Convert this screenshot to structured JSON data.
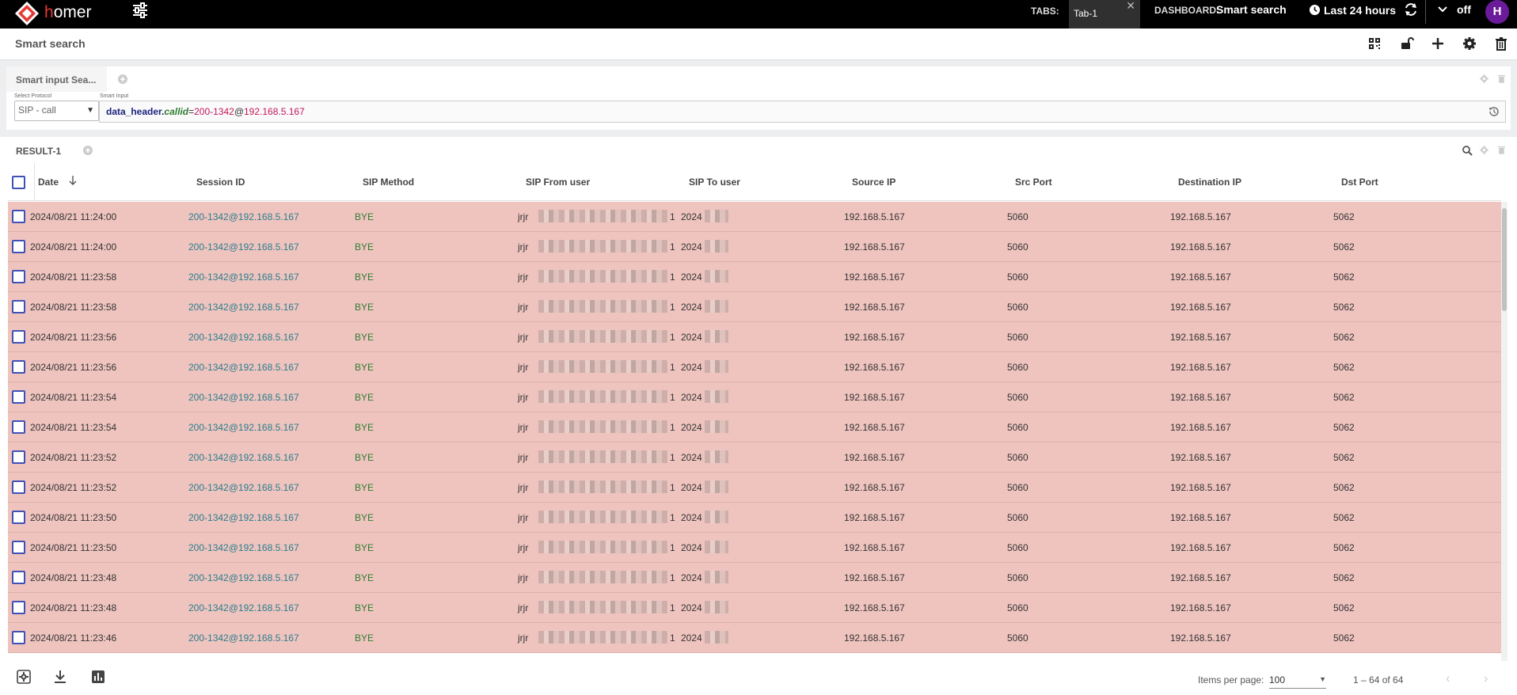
{
  "app": {
    "logo_h": "h",
    "logo_rest": "omer"
  },
  "topbar": {
    "tabs_label": "TABS:",
    "active_tab": "Tab-1",
    "dashboard_label": "DASHBOARD:",
    "dashboard_name": "Smart search",
    "time_range": "Last 24 hours",
    "toggle_label": "off",
    "avatar_initial": "H"
  },
  "page": {
    "title": "Smart search"
  },
  "smart_input_panel": {
    "tab_label": "Smart input Sea...",
    "select_protocol_label": "Select Protocol",
    "smart_input_label": "Smart Input",
    "protocol_value": "SIP - call",
    "query": {
      "key": "data_header",
      "field": "callid",
      "op": "=",
      "value_user": "200-1342",
      "at": "@",
      "value_host": "192.168.5.167"
    }
  },
  "result_panel": {
    "title": "RESULT-1",
    "columns": [
      "Date",
      "Session ID",
      "SIP Method",
      "SIP From user",
      "SIP To user",
      "Source IP",
      "Src Port",
      "Destination IP",
      "Dst Port"
    ],
    "rows": [
      {
        "date": "2024/08/21 11:24:00",
        "sid": "200-1342@192.168.5.167",
        "method": "BYE",
        "from": "jrjr",
        "from_end": "1",
        "to": "2024",
        "src": "192.168.5.167",
        "sport": "5060",
        "dst": "192.168.5.167",
        "dport": "5062"
      },
      {
        "date": "2024/08/21 11:24:00",
        "sid": "200-1342@192.168.5.167",
        "method": "BYE",
        "from": "jrjr",
        "from_end": "1",
        "to": "2024",
        "src": "192.168.5.167",
        "sport": "5060",
        "dst": "192.168.5.167",
        "dport": "5062"
      },
      {
        "date": "2024/08/21 11:23:58",
        "sid": "200-1342@192.168.5.167",
        "method": "BYE",
        "from": "jrjr",
        "from_end": "1",
        "to": "2024",
        "src": "192.168.5.167",
        "sport": "5060",
        "dst": "192.168.5.167",
        "dport": "5062"
      },
      {
        "date": "2024/08/21 11:23:58",
        "sid": "200-1342@192.168.5.167",
        "method": "BYE",
        "from": "jrjr",
        "from_end": "1",
        "to": "2024",
        "src": "192.168.5.167",
        "sport": "5060",
        "dst": "192.168.5.167",
        "dport": "5062"
      },
      {
        "date": "2024/08/21 11:23:56",
        "sid": "200-1342@192.168.5.167",
        "method": "BYE",
        "from": "jrjr",
        "from_end": "1",
        "to": "2024",
        "src": "192.168.5.167",
        "sport": "5060",
        "dst": "192.168.5.167",
        "dport": "5062"
      },
      {
        "date": "2024/08/21 11:23:56",
        "sid": "200-1342@192.168.5.167",
        "method": "BYE",
        "from": "jrjr",
        "from_end": "1",
        "to": "2024",
        "src": "192.168.5.167",
        "sport": "5060",
        "dst": "192.168.5.167",
        "dport": "5062"
      },
      {
        "date": "2024/08/21 11:23:54",
        "sid": "200-1342@192.168.5.167",
        "method": "BYE",
        "from": "jrjr",
        "from_end": "1",
        "to": "2024",
        "src": "192.168.5.167",
        "sport": "5060",
        "dst": "192.168.5.167",
        "dport": "5062"
      },
      {
        "date": "2024/08/21 11:23:54",
        "sid": "200-1342@192.168.5.167",
        "method": "BYE",
        "from": "jrjr",
        "from_end": "1",
        "to": "2024",
        "src": "192.168.5.167",
        "sport": "5060",
        "dst": "192.168.5.167",
        "dport": "5062"
      },
      {
        "date": "2024/08/21 11:23:52",
        "sid": "200-1342@192.168.5.167",
        "method": "BYE",
        "from": "jrjr",
        "from_end": "1",
        "to": "2024",
        "src": "192.168.5.167",
        "sport": "5060",
        "dst": "192.168.5.167",
        "dport": "5062"
      },
      {
        "date": "2024/08/21 11:23:52",
        "sid": "200-1342@192.168.5.167",
        "method": "BYE",
        "from": "jrjr",
        "from_end": "1",
        "to": "2024",
        "src": "192.168.5.167",
        "sport": "5060",
        "dst": "192.168.5.167",
        "dport": "5062"
      },
      {
        "date": "2024/08/21 11:23:50",
        "sid": "200-1342@192.168.5.167",
        "method": "BYE",
        "from": "jrjr",
        "from_end": "1",
        "to": "2024",
        "src": "192.168.5.167",
        "sport": "5060",
        "dst": "192.168.5.167",
        "dport": "5062"
      },
      {
        "date": "2024/08/21 11:23:50",
        "sid": "200-1342@192.168.5.167",
        "method": "BYE",
        "from": "jrjr",
        "from_end": "1",
        "to": "2024",
        "src": "192.168.5.167",
        "sport": "5060",
        "dst": "192.168.5.167",
        "dport": "5062"
      },
      {
        "date": "2024/08/21 11:23:48",
        "sid": "200-1342@192.168.5.167",
        "method": "BYE",
        "from": "jrjr",
        "from_end": "1",
        "to": "2024",
        "src": "192.168.5.167",
        "sport": "5060",
        "dst": "192.168.5.167",
        "dport": "5062"
      },
      {
        "date": "2024/08/21 11:23:48",
        "sid": "200-1342@192.168.5.167",
        "method": "BYE",
        "from": "jrjr",
        "from_end": "1",
        "to": "2024",
        "src": "192.168.5.167",
        "sport": "5060",
        "dst": "192.168.5.167",
        "dport": "5062"
      },
      {
        "date": "2024/08/21 11:23:46",
        "sid": "200-1342@192.168.5.167",
        "method": "BYE",
        "from": "jrjr",
        "from_end": "1",
        "to": "2024",
        "src": "192.168.5.167",
        "sport": "5060",
        "dst": "192.168.5.167",
        "dport": "5062"
      }
    ],
    "items_per_page_label": "Items per page:",
    "items_per_page_value": "100",
    "range_label": "1 – 64 of 64"
  },
  "colors": {
    "row_highlight": "#efc4bf",
    "accent": "#3f51b5",
    "session_id": "#2a7d8c",
    "method": "#2e7d32",
    "avatar": "#6a1b9a"
  },
  "icons": [
    "homer-logo-icon",
    "sliders-icon",
    "close-icon",
    "clock-icon",
    "refresh-icon",
    "chevron-down-icon",
    "qr-grid-icon",
    "unlock-icon",
    "plus-icon",
    "gear-icon",
    "trash-icon",
    "add-circle-icon",
    "history-icon",
    "search-icon",
    "arrow-down-icon",
    "download-icon",
    "bar-chart-icon",
    "chevron-left-icon",
    "chevron-right-icon"
  ]
}
